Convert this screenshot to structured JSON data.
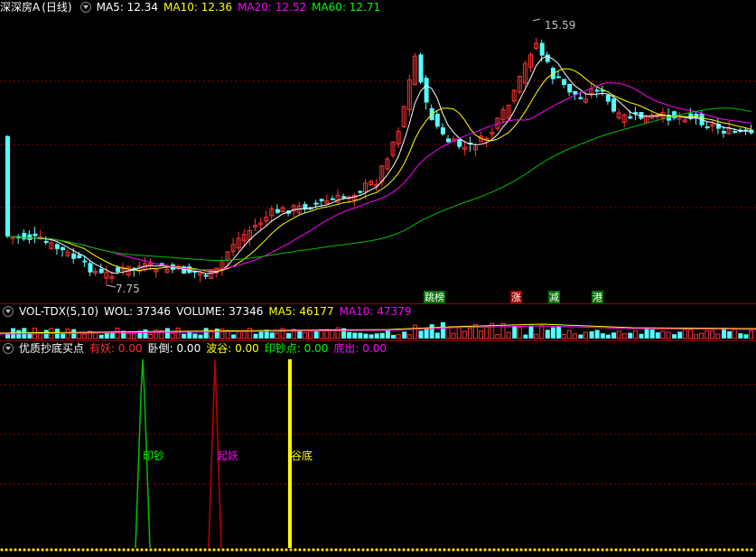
{
  "main_panel": {
    "stock_name": "深深房A",
    "period": "(日线)",
    "indicators": [
      {
        "label": "MA5: 12.34",
        "color": "#ffffff"
      },
      {
        "label": "MA10: 12.36",
        "color": "#ffff00"
      },
      {
        "label": "MA20: 12.52",
        "color": "#ff00ff"
      },
      {
        "label": "MA60: 12.71",
        "color": "#00ff00"
      }
    ],
    "high_label": "15.59",
    "low_label": "7.75",
    "signal_labels": [
      {
        "text": "跳榜",
        "color": "#ffffff",
        "bg": "#007000"
      },
      {
        "text": "涨",
        "color": "#ffffff",
        "bg": "#a00000"
      },
      {
        "text": "减",
        "color": "#ffffff",
        "bg": "#007000"
      },
      {
        "text": "港",
        "color": "#ffffff",
        "bg": "#007000"
      }
    ]
  },
  "vol_panel": {
    "name": "VOL-TDX(5,10)",
    "items": [
      {
        "label": "WOL: 37346",
        "color": "#ffffff"
      },
      {
        "label": "VOLUME: 37346",
        "color": "#ffffff"
      },
      {
        "label": "MA5: 46177",
        "color": "#ffff00"
      },
      {
        "label": "MA10: 47379",
        "color": "#ff00ff"
      }
    ]
  },
  "signal_panel": {
    "name": "优质抄底买点",
    "items": [
      {
        "label": "有妖:",
        "value": "0.00",
        "color": "#ff3030"
      },
      {
        "label": "卧倒:",
        "value": "0.00",
        "color": "#ffffff"
      },
      {
        "label": "波谷:",
        "value": "0.00",
        "color": "#ffff00"
      },
      {
        "label": "印钞点:",
        "value": "0.00",
        "color": "#00ff00"
      },
      {
        "label": "底出:",
        "value": "0.00",
        "color": "#ff00ff"
      }
    ],
    "peak_labels": [
      {
        "text": "印钞",
        "color": "#00ff00"
      },
      {
        "text": "起妖",
        "color": "#ff00ff"
      },
      {
        "text": "谷底",
        "color": "#ffff00"
      }
    ]
  },
  "colors": {
    "up": "#ff3232",
    "down": "#54ffff",
    "ma5": "#ffffff",
    "ma10": "#ffff00",
    "ma20": "#ff00ff",
    "ma60": "#00c000"
  }
}
